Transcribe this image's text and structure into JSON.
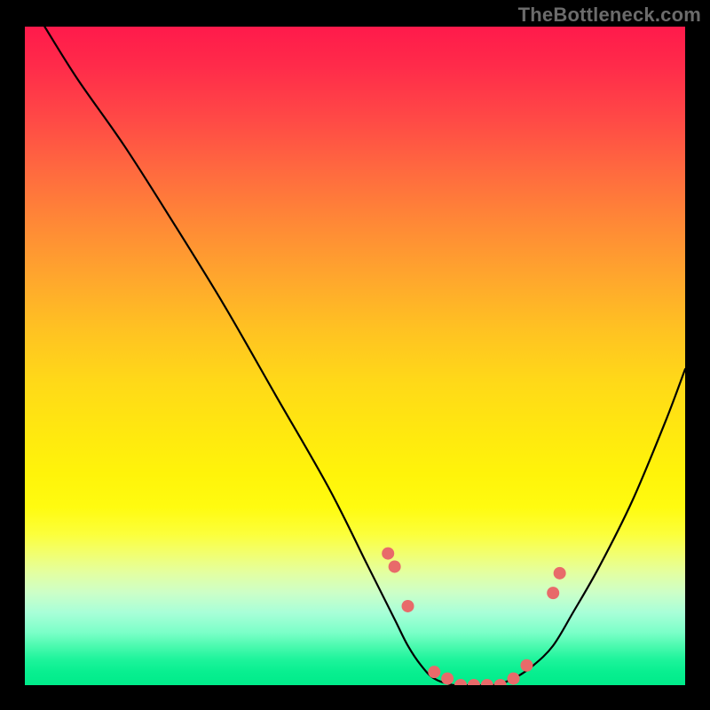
{
  "watermark": "TheBottleneck.com",
  "chart_data": {
    "type": "line",
    "title": "",
    "xlabel": "",
    "ylabel": "",
    "xlim": [
      0,
      100
    ],
    "ylim": [
      0,
      100
    ],
    "grid": false,
    "legend": false,
    "series": [
      {
        "name": "bottleneck-curve",
        "x": [
          3,
          8,
          15,
          22,
          30,
          38,
          46,
          52,
          56,
          58,
          60,
          62,
          65,
          68,
          71,
          74,
          77,
          80,
          83,
          87,
          92,
          97,
          100
        ],
        "y": [
          100,
          92,
          82,
          71,
          58,
          44,
          30,
          18,
          10,
          6,
          3,
          1,
          0,
          0,
          0,
          1,
          3,
          6,
          11,
          18,
          28,
          40,
          48
        ]
      }
    ],
    "markers": {
      "name": "highlight-dots",
      "color": "#e86a6a",
      "x": [
        55,
        56,
        58,
        62,
        64,
        66,
        68,
        70,
        72,
        74,
        76,
        80,
        81
      ],
      "y": [
        20,
        18,
        12,
        2,
        1,
        0,
        0,
        0,
        0,
        1,
        3,
        14,
        17
      ]
    }
  }
}
